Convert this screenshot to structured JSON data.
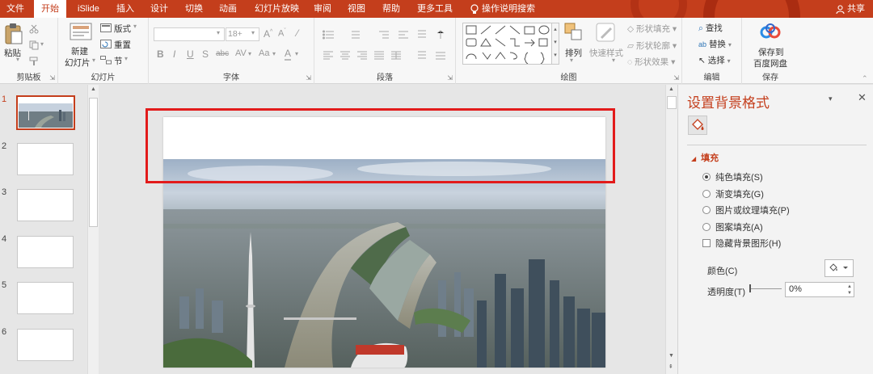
{
  "tabs": [
    {
      "label": "文件",
      "active": false
    },
    {
      "label": "开始",
      "active": true
    },
    {
      "label": "iSlide",
      "active": false
    },
    {
      "label": "插入",
      "active": false
    },
    {
      "label": "设计",
      "active": false
    },
    {
      "label": "切换",
      "active": false
    },
    {
      "label": "动画",
      "active": false
    },
    {
      "label": "幻灯片放映",
      "active": false
    },
    {
      "label": "审阅",
      "active": false
    },
    {
      "label": "视图",
      "active": false
    },
    {
      "label": "帮助",
      "active": false
    },
    {
      "label": "更多工具",
      "active": false
    }
  ],
  "tell_me": "操作说明搜索",
  "share": "共享",
  "ribbon": {
    "clipboard": {
      "label": "剪贴板",
      "paste": "粘贴"
    },
    "slides": {
      "label": "幻灯片",
      "new_slide_line1": "新建",
      "new_slide_line2": "幻灯片",
      "layout": "版式",
      "reset": "重置",
      "section": "节"
    },
    "font": {
      "label": "字体",
      "size": "18+"
    },
    "paragraph": {
      "label": "段落"
    },
    "drawing": {
      "label": "绘图",
      "arrange": "排列",
      "quick_styles": "快速样式",
      "shape_fill": "形状填充",
      "shape_outline": "形状轮廓",
      "shape_effects": "形状效果"
    },
    "editing": {
      "label": "编辑",
      "find": "查找",
      "replace": "替换",
      "select": "选择"
    },
    "save": {
      "label": "保存",
      "line1": "保存到",
      "line2": "百度网盘"
    }
  },
  "slides": [
    {
      "num": "1",
      "selected": true
    },
    {
      "num": "2",
      "selected": false
    },
    {
      "num": "3",
      "selected": false
    },
    {
      "num": "4",
      "selected": false
    },
    {
      "num": "5",
      "selected": false
    },
    {
      "num": "6",
      "selected": false
    }
  ],
  "pane": {
    "title": "设置背景格式",
    "section": "填充",
    "options": [
      {
        "label": "纯色填充(S)",
        "checked": true
      },
      {
        "label": "渐变填充(G)",
        "checked": false
      },
      {
        "label": "图片或纹理填充(P)",
        "checked": false
      },
      {
        "label": "图案填充(A)",
        "checked": false
      }
    ],
    "hide_graphics": "隐藏背景图形(H)",
    "color_label": "颜色(C)",
    "transparency_label": "透明度(T)",
    "transparency_value": "0%"
  },
  "colors": {
    "accent": "#c43e1c",
    "highlight": "#e21b1b"
  }
}
